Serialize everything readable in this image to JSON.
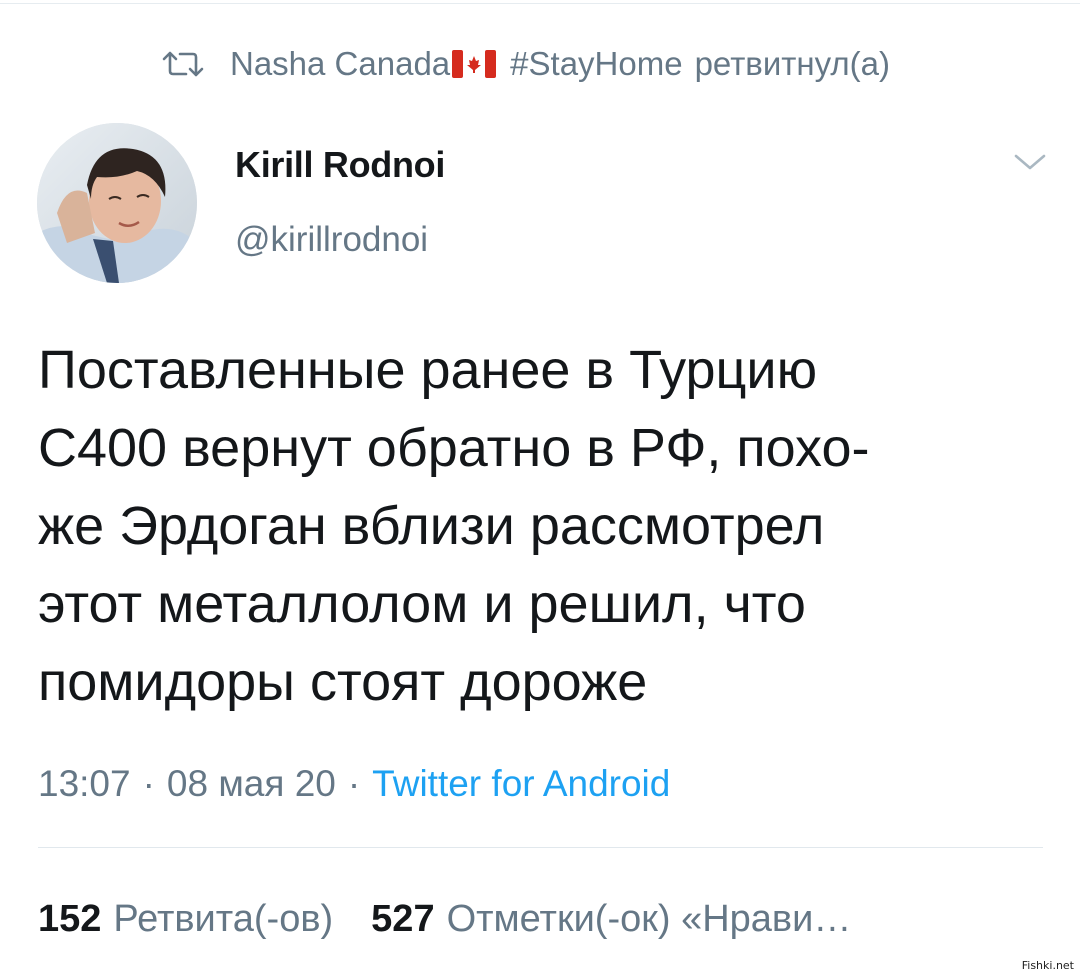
{
  "retweet": {
    "icon": "retweet-icon",
    "user": "Nasha Canada",
    "flag": "canada-flag-icon",
    "hashtag": "#StayHome",
    "action": "ретвитнул(а)"
  },
  "author": {
    "name": "Kirill Rodnoi",
    "handle": "@kirillrodnoi"
  },
  "tweet": {
    "lines": [
      "Поставленные ранее в Турцию",
      "С400 вернут обратно в РФ, похо-",
      "же Эрдоган вблизи рассмотрел",
      "этот металлолом и решил, что",
      "помидоры стоят дороже"
    ]
  },
  "meta": {
    "time": "13:07",
    "separator": "·",
    "date": "08 мая 20",
    "source": "Twitter for Android"
  },
  "stats": {
    "retweets_count": "152",
    "retweets_label": "Ретвита(-ов)",
    "likes_count": "527",
    "likes_label": "Отметки(-ок) «Нрави…"
  },
  "watermark": "Fishki.net",
  "colors": {
    "text": "#14171a",
    "secondary": "#657786",
    "link": "#1da1f2",
    "divider": "#e1e8ed"
  }
}
